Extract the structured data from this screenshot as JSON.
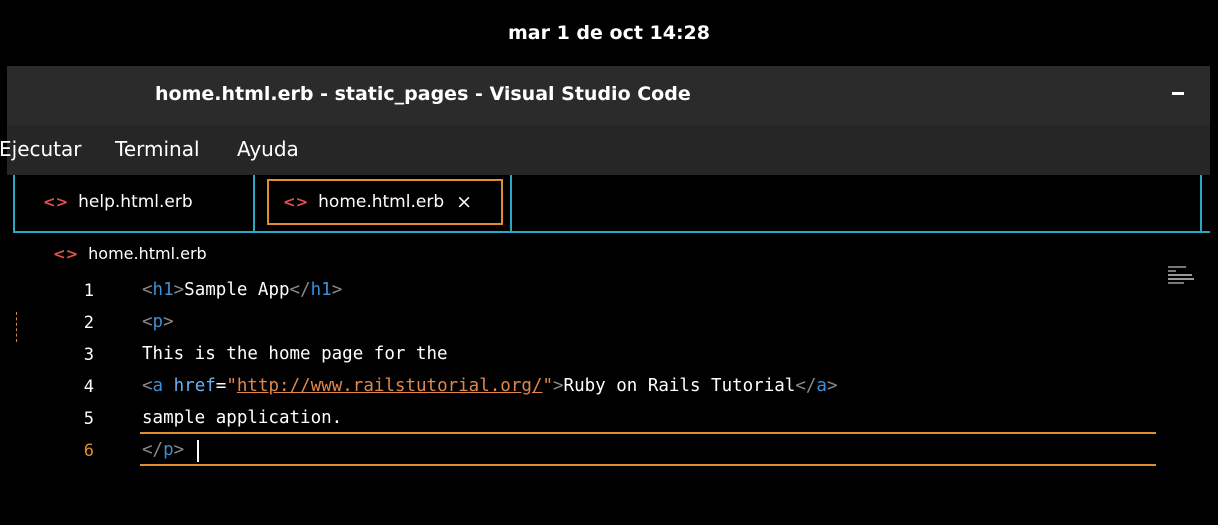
{
  "system": {
    "clock": "mar   1 de oct  14:28"
  },
  "window": {
    "title": "home.html.erb - static_pages - Visual Studio Code"
  },
  "menu": [
    "Ejecutar",
    "Terminal",
    "Ayuda"
  ],
  "tabs": [
    {
      "label": "help.html.erb",
      "icon": "html-file-icon",
      "active": false
    },
    {
      "label": "home.html.erb",
      "icon": "html-file-icon",
      "active": true,
      "close": "×"
    }
  ],
  "breadcrumb": {
    "label": "home.html.erb"
  },
  "editor": {
    "line_numbers": [
      "1",
      "2",
      "3",
      "4",
      "5",
      "6"
    ],
    "lines": [
      {
        "open": "<",
        "tag": "h1",
        "close": ">",
        "text": "Sample App",
        "end_open": "</",
        "end_tag": "h1",
        "end_close": ">"
      },
      {
        "open": "<",
        "tag": "p",
        "close": ">"
      },
      {
        "text": "This is the home page for the"
      },
      {
        "open": "<",
        "tag": "a",
        "attr": "href",
        "eq": "=",
        "quote1": "\"",
        "url": "http://www.railstutorial.org/",
        "quote2": "\"",
        "close": ">",
        "text": "Ruby on Rails Tutorial",
        "end_open": "</",
        "end_tag": "a",
        "end_close": ">"
      },
      {
        "text": "sample application."
      },
      {
        "end_open": "</",
        "end_tag": "p",
        "end_close": ">"
      }
    ],
    "current_line": 6
  },
  "colors": {
    "accent_orange": "#e08e2b",
    "accent_cyan": "#29a8c4",
    "tag_blue": "#3d8fd6"
  }
}
